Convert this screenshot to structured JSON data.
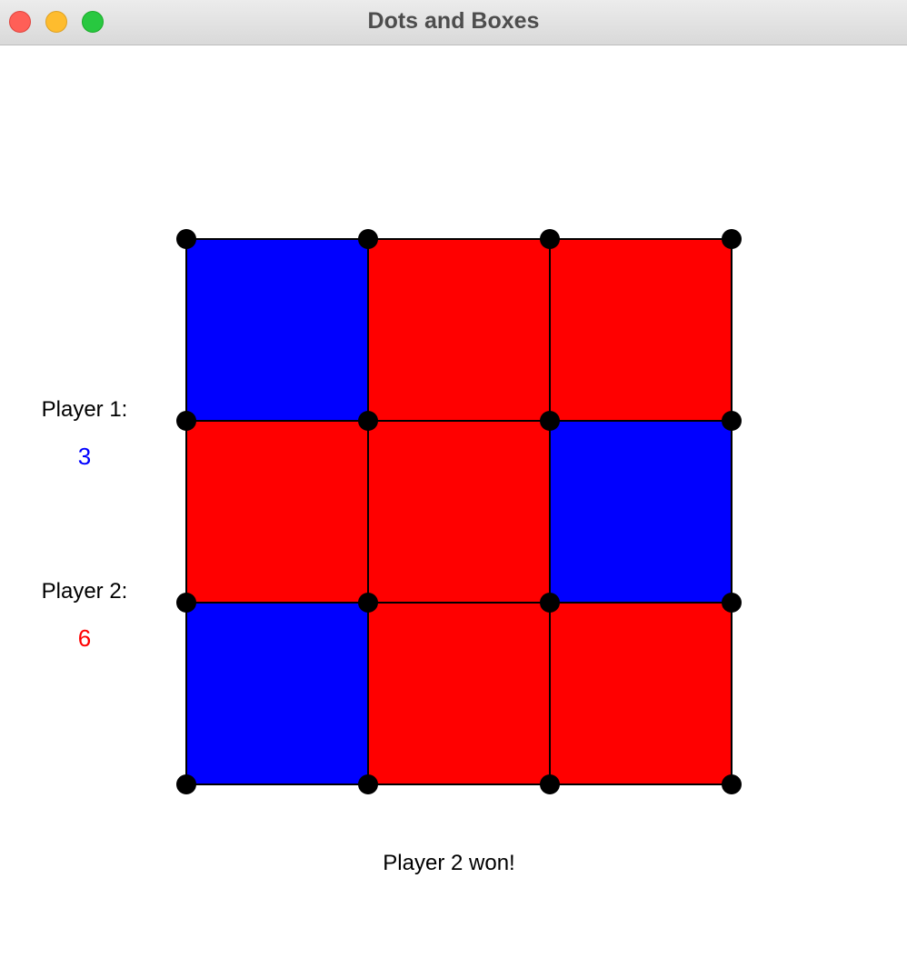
{
  "window": {
    "title": "Dots and Boxes"
  },
  "players": [
    {
      "label": "Player 1:",
      "score": "3",
      "color": "#0000ff"
    },
    {
      "label": "Player 2:",
      "score": "6",
      "color": "#ff0000"
    }
  ],
  "board": {
    "rows": 3,
    "cols": 3,
    "owners": [
      [
        1,
        2,
        2
      ],
      [
        2,
        2,
        1
      ],
      [
        1,
        2,
        2
      ]
    ],
    "line_color": "#000000",
    "dot_color": "#000000"
  },
  "status": "Player 2 won!"
}
